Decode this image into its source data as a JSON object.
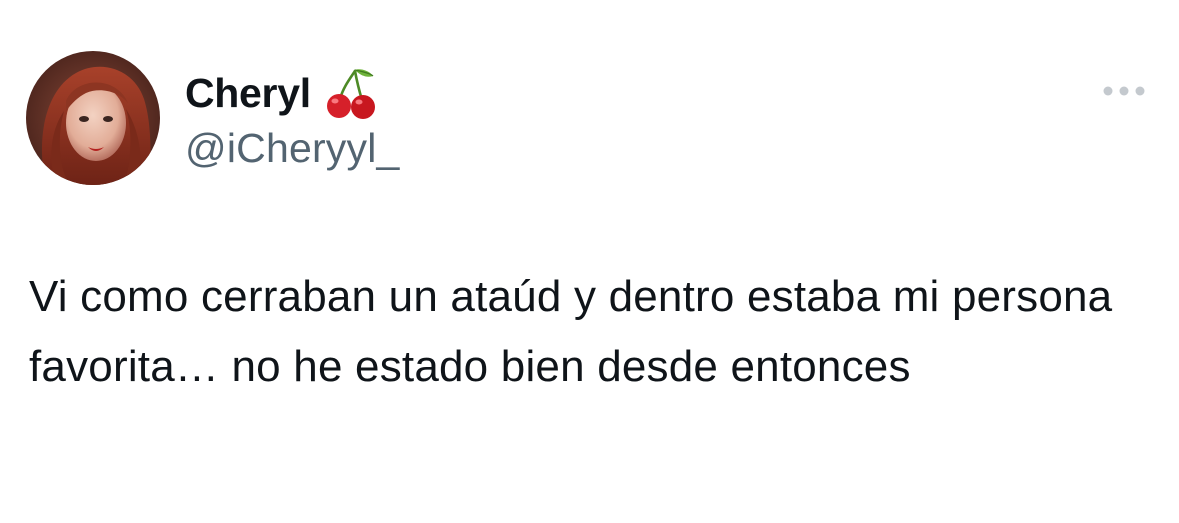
{
  "author": {
    "display_name": "Cheryl",
    "handle": "@iCheryyl_",
    "name_emoji_icon": "cherries-icon",
    "avatar_icon": "profile-photo"
  },
  "tweet": {
    "text": "Vi como cerraban un ataúd y dentro estaba mi persona favorita… no he estado bien desde entonces"
  },
  "more_icon": "more-options-icon",
  "colors": {
    "text_primary": "#0f1419",
    "text_secondary": "#536471",
    "more_dots": "#c4c9ce",
    "background": "#ffffff"
  }
}
